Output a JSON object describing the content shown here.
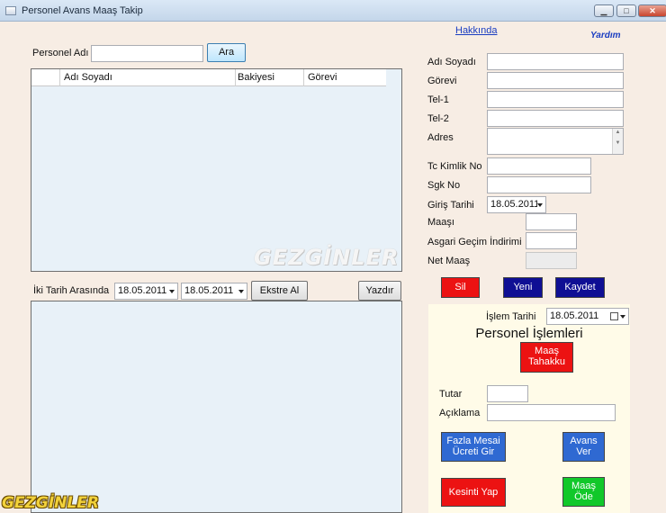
{
  "window": {
    "title": "Personel Avans Maaş Takip"
  },
  "menu": {
    "about": "Hakkında",
    "help": "Yardım"
  },
  "search": {
    "label": "Personel Adı",
    "value": "",
    "button": "Ara"
  },
  "grid": {
    "columns": [
      "Adı Soyadı",
      "Bakiyesi",
      "Görevi"
    ],
    "rows": []
  },
  "form": {
    "fields": [
      {
        "label": "Adı Soyadı",
        "value": ""
      },
      {
        "label": "Görevi",
        "value": ""
      },
      {
        "label": "Tel-1",
        "value": ""
      },
      {
        "label": "Tel-2",
        "value": ""
      },
      {
        "label": "Adres",
        "value": ""
      },
      {
        "label": "Tc Kimlik No",
        "value": ""
      },
      {
        "label": "Sgk No",
        "value": ""
      },
      {
        "label": "Giriş Tarihi",
        "value": "18.05.2011"
      },
      {
        "label": "Maaşı",
        "value": ""
      },
      {
        "label": "Asgari Geçim İndirimi",
        "value": ""
      },
      {
        "label": "Net Maaş",
        "value": ""
      }
    ],
    "buttons": {
      "delete": "Sil",
      "new": "Yeni",
      "save": "Kaydet"
    }
  },
  "range": {
    "label": "İki Tarih Arasında",
    "from": "18.05.2011",
    "to": "18.05.2011",
    "statement_button": "Ekstre Al",
    "print_button": "Yazdır"
  },
  "ops": {
    "date_label": "İşlem Tarihi",
    "date_value": "18.05.2011",
    "title": "Personel İşlemleri",
    "salary_accrual": "Maaş Tahakku",
    "amount_label": "Tutar",
    "amount_value": "",
    "note_label": "Açıklama",
    "note_value": "",
    "overtime": "Fazla Mesai Ücreti Gir",
    "advance": "Avans Ver",
    "deduction": "Kesinti Yap",
    "pay_salary": "Maaş Öde"
  },
  "watermarks": {
    "center": "GEZGİNLER",
    "corner": "GEZGİNLER"
  },
  "colors": {
    "background": "#f7ede4",
    "red": "#ec1212",
    "navy": "#0f0f94",
    "blue": "#2f69d2",
    "green": "#11c82a",
    "panel": "#fffbe8",
    "grid": "#e8f1f8"
  }
}
